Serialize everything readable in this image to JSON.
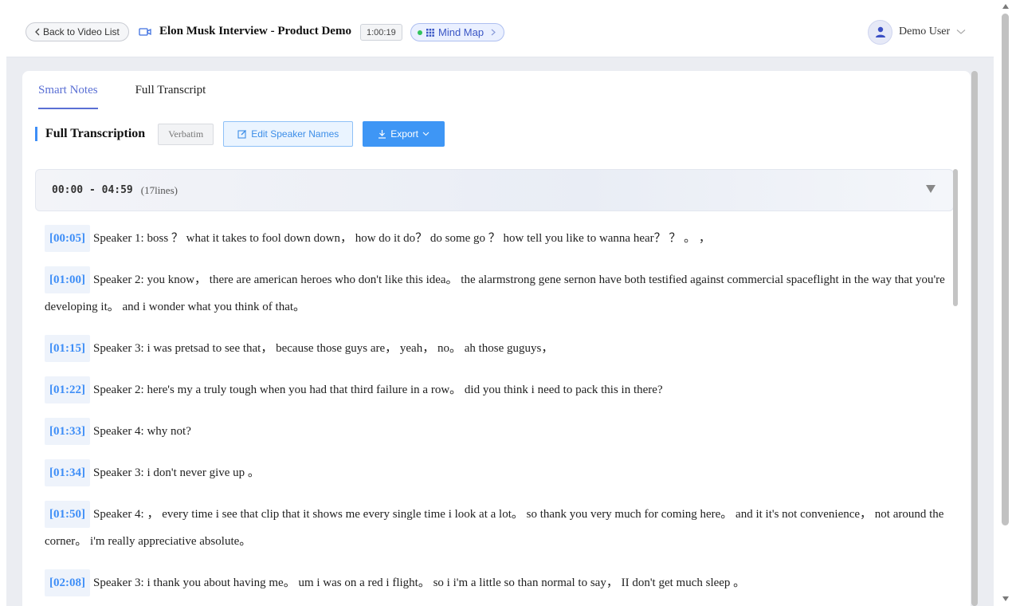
{
  "header": {
    "back_label": "Back to Video List",
    "video_title": "Elon Musk Interview - Product Demo",
    "duration": "1:00:19",
    "mindmap_label": "Mind Map",
    "user_name": "Demo User"
  },
  "tabs": [
    {
      "label": "Smart Notes",
      "active": true
    },
    {
      "label": "Full Transcript",
      "active": false
    }
  ],
  "toolbar": {
    "section_title": "Full Transcription",
    "verbatim_label": "Verbatim",
    "edit_label": "Edit Speaker Names",
    "export_label": "Export"
  },
  "segment": {
    "range": "00:00 - 04:59",
    "lines_count": "(17lines)"
  },
  "lines": [
    {
      "time": "[00:05]",
      "text": "Speaker 1: boss ？ what it takes to fool down down， how do it do？ do some go ？ how tell you like to wanna hear？ ？ 。 ，"
    },
    {
      "time": "[01:00]",
      "text": "Speaker 2: you know， there are american heroes who don't like this idea。 the alarmstrong gene sernon have both testified against commercial spaceflight in the way that you're developing it。 and i wonder what you think of that。"
    },
    {
      "time": "[01:15]",
      "text": "Speaker 3: i was pretsad to see that， because those guys are， yeah， no。 ah those guguys，"
    },
    {
      "time": "[01:22]",
      "text": "Speaker 2: here's my a truly tough when you had that third failure in a row。 did you think i need to pack this in there?"
    },
    {
      "time": "[01:33]",
      "text": "Speaker 4: why not?"
    },
    {
      "time": "[01:34]",
      "text": "Speaker 3: i don't never give up 。"
    },
    {
      "time": "[01:50]",
      "text": "Speaker 4: ， every time i see that clip that it shows me every single time i look at a lot。 so thank you very much for coming here。 and it it's not convenience， not around the corner。 i'm really appreciative absolute。"
    },
    {
      "time": "[02:08]",
      "text": "Speaker 3: i thank you about having me。 um i was on a red i flight。 so i i'm a little so than normal to say， II don't get much sleep 。"
    }
  ],
  "colors": {
    "accent": "#3e8ef7",
    "tab_active": "#5a6fd4",
    "timestamp_bg": "#eef3fb"
  }
}
